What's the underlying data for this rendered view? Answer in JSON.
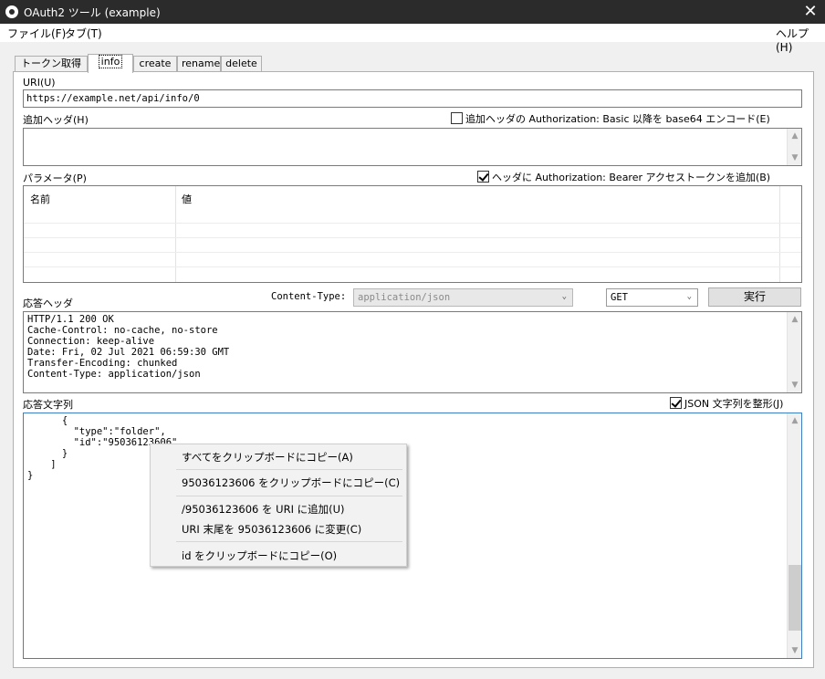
{
  "window": {
    "title": "OAuth2 ツール (example)",
    "close": "✕"
  },
  "menu": {
    "file": "ファイル(F)",
    "tab": "タブ(T)",
    "help": "ヘルプ(H)"
  },
  "tabs": [
    "トークン取得",
    "info",
    "create",
    "rename",
    "delete"
  ],
  "uri": {
    "label": "URI(U)",
    "value": "https://example.net/api/info/0"
  },
  "extra_header": {
    "label": "追加ヘッダ(H)",
    "checkbox_label": "追加ヘッダの Authorization: Basic 以降を base64 エンコード(E)",
    "checked": false
  },
  "params": {
    "label": "パラメータ(P)",
    "checkbox_label": "ヘッダに Authorization: Bearer アクセストークンを追加(B)",
    "checked": true,
    "columns": [
      "名前",
      "値"
    ]
  },
  "response_header": {
    "label": "応答ヘッダ",
    "content_type_label": "Content-Type:",
    "content_type_value": "application/json",
    "method": "GET",
    "run_button": "実行",
    "text": "HTTP/1.1 200 OK\nCache-Control: no-cache, no-store\nConnection: keep-alive\nDate: Fri, 02 Jul 2021 06:59:30 GMT\nTransfer-Encoding: chunked\nContent-Type: application/json"
  },
  "response_body": {
    "label": "応答文字列",
    "checkbox_label": "JSON 文字列を整形(J)",
    "checked": true,
    "text": "      {\n        \"type\":\"folder\",\n        \"id\":\"95036123606\"\n      }\n    ]\n}"
  },
  "context_menu": {
    "items": [
      "すべてをクリップボードにコピー(A)",
      "95036123606 をクリップボードにコピー(C)",
      "/95036123606 を URI に追加(U)",
      "URI 末尾を 95036123606 に変更(C)",
      "id をクリップボードにコピー(O)"
    ]
  },
  "icons": {
    "scroll_up": "▲",
    "scroll_down": "▼",
    "dropdown": "⌄"
  }
}
